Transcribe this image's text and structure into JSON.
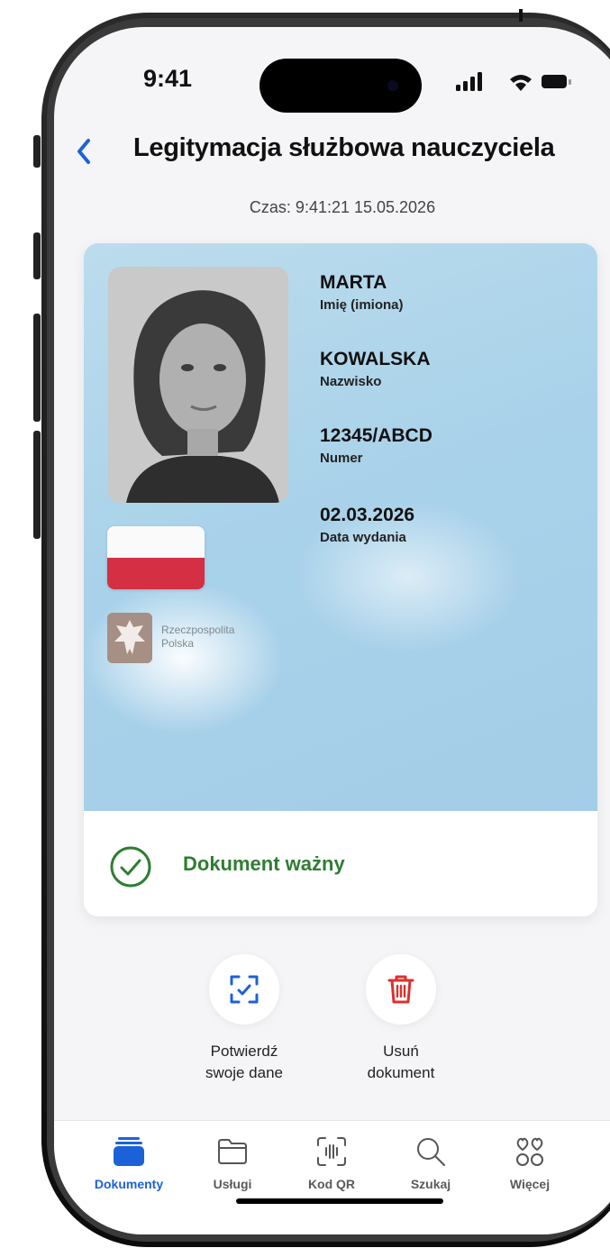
{
  "status_bar": {
    "time": "9:41"
  },
  "header": {
    "title": "Legitymacja służbowa nauczyciela"
  },
  "timestamp": "Czas: 9:41:21 15.05.2026",
  "document": {
    "fields": [
      {
        "value": "MARTA",
        "label": "Imię (imiona)"
      },
      {
        "value": "KOWALSKA",
        "label": "Nazwisko"
      },
      {
        "value": "12345/ABCD",
        "label": "Numer"
      },
      {
        "value": "02.03.2026",
        "label": "Data wydania"
      }
    ],
    "emblem_line1": "Rzeczpospolita",
    "emblem_line2": "Polska",
    "status": "Dokument ważny",
    "status_color": "#2f7d32"
  },
  "actions": [
    {
      "line1": "Potwierdź",
      "line2": "swoje dane",
      "icon": "scan-check-icon"
    },
    {
      "line1": "Usuń",
      "line2": "dokument",
      "icon": "trash-icon"
    }
  ],
  "tabs": [
    {
      "label": "Dokumenty",
      "icon": "wallet-icon",
      "active": true
    },
    {
      "label": "Usługi",
      "icon": "folder-icon"
    },
    {
      "label": "Kod QR",
      "icon": "qr-scan-icon"
    },
    {
      "label": "Szukaj",
      "icon": "search-icon"
    },
    {
      "label": "Więcej",
      "icon": "more-grid-icon"
    }
  ],
  "colors": {
    "accent": "#1b62d8",
    "danger": "#d9332f",
    "flag_red": "#d42f43"
  }
}
